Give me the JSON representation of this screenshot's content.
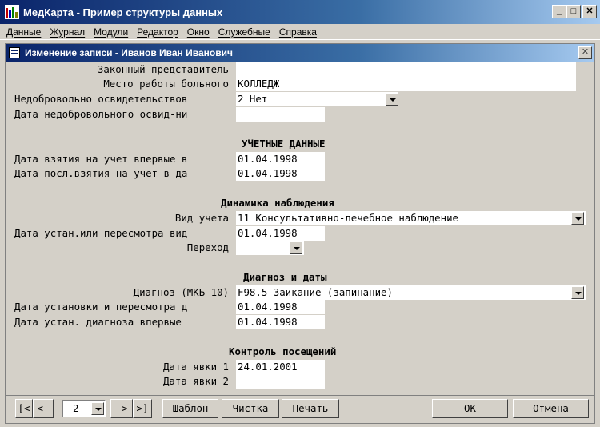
{
  "window": {
    "title": "МедКарта - Пример структуры данных",
    "min": "_",
    "max": "□",
    "close": "✕"
  },
  "menu": [
    "Данные",
    "Журнал",
    "Модули",
    "Редактор",
    "Окно",
    "Служебные",
    "Справка"
  ],
  "child": {
    "title": "Изменение записи - Иванов Иван Иванович",
    "close": "✕"
  },
  "form": {
    "legal_rep": {
      "label": "Законный представитель",
      "value": ""
    },
    "workplace": {
      "label": "Место работы больного",
      "value": "КОЛЛЕДЖ"
    },
    "involuntary": {
      "label": "Недобровольно освидетельствов",
      "value": "2  Нет"
    },
    "involuntary_date": {
      "label": "Дата недобровольного освид-ни",
      "value": ""
    },
    "section_account": "УЧЕТНЫЕ ДАННЫЕ",
    "first_reg_date": {
      "label": "Дата взятия на учет впервые в",
      "value": "01.04.1998"
    },
    "last_reg_date": {
      "label": "Дата посл.взятия на учет в да",
      "value": "01.04.1998"
    },
    "section_dynamics": "Динамика наблюдения",
    "account_type": {
      "label": "Вид учета",
      "value": "11 Консультативно-лечебное наблюдение"
    },
    "account_type_date": {
      "label": "Дата устан.или пересмотра вид",
      "value": "01.04.1998"
    },
    "transition": {
      "label": "Переход",
      "value": ""
    },
    "section_diagnosis": "Диагноз и даты",
    "diagnosis": {
      "label": "Диагноз (МКБ-10)",
      "value": "F98.5 Заикание (запинание)"
    },
    "diagnosis_review_date": {
      "label": "Дата установки и пересмотра д",
      "value": "01.04.1998"
    },
    "diagnosis_first_date": {
      "label": "Дата устан. диагноза впервые",
      "value": "01.04.1998"
    },
    "section_visits": "Контроль посещений",
    "visit1": {
      "label": "Дата явки 1",
      "value": "24.01.2001"
    },
    "visit2": {
      "label": "Дата явки 2",
      "value": ""
    }
  },
  "toolbar": {
    "first": "[<",
    "prev": "<-",
    "page": "2",
    "next": "->",
    "last": ">]",
    "template": "Шаблон",
    "clear": "Чистка",
    "print": "Печать",
    "ok": "OK",
    "cancel": "Отмена"
  },
  "colors": {
    "titlebar_start": "#0a246a",
    "titlebar_end": "#a6caf0",
    "face": "#d4d0c8"
  }
}
